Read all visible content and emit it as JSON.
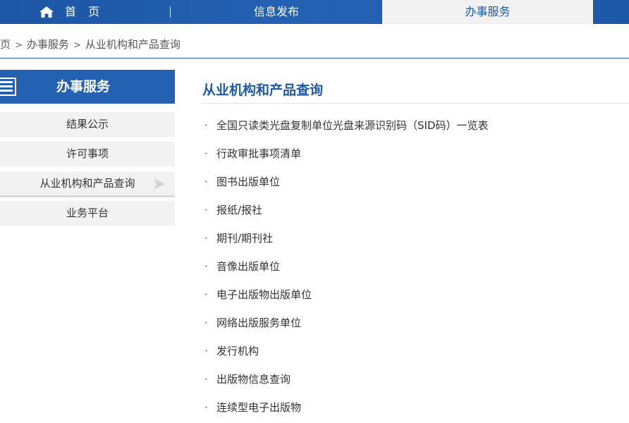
{
  "nav": {
    "home_label": "首 页",
    "info_label": "信息发布",
    "service_label": "办事服务"
  },
  "breadcrumb": {
    "home_partial": "页",
    "separator": ">",
    "service": "办事服务",
    "current": "从业机构和产品查询"
  },
  "sidebar": {
    "title": "办事服务",
    "items": [
      {
        "label": "结果公示"
      },
      {
        "label": "许可事项"
      },
      {
        "label": "从业机构和产品查询"
      },
      {
        "label": "业务平台"
      }
    ]
  },
  "main": {
    "section_title": "从业机构和产品查询",
    "bullet": "·",
    "links": [
      {
        "label": "全国只读类光盘复制单位光盘来源识别码（SID码）一览表"
      },
      {
        "label": "行政审批事项清单"
      },
      {
        "label": "图书出版单位"
      },
      {
        "label": "报纸/报社"
      },
      {
        "label": "期刊/期刊社"
      },
      {
        "label": "音像出版单位"
      },
      {
        "label": "电子出版物出版单位"
      },
      {
        "label": "网络出版服务单位"
      },
      {
        "label": "发行机构"
      },
      {
        "label": "出版物信息查询"
      },
      {
        "label": "连续型电子出版物"
      }
    ]
  },
  "colors": {
    "brand_blue": "#2561b3",
    "nav_active_bg": "#f2f2f2",
    "sidebar_item_bg": "#f2f2f2",
    "title_blue": "#1f5aa6"
  },
  "icons": {
    "home": "home-icon",
    "sidebar_header": "document-icon",
    "active_item": "arrow-right-icon"
  }
}
